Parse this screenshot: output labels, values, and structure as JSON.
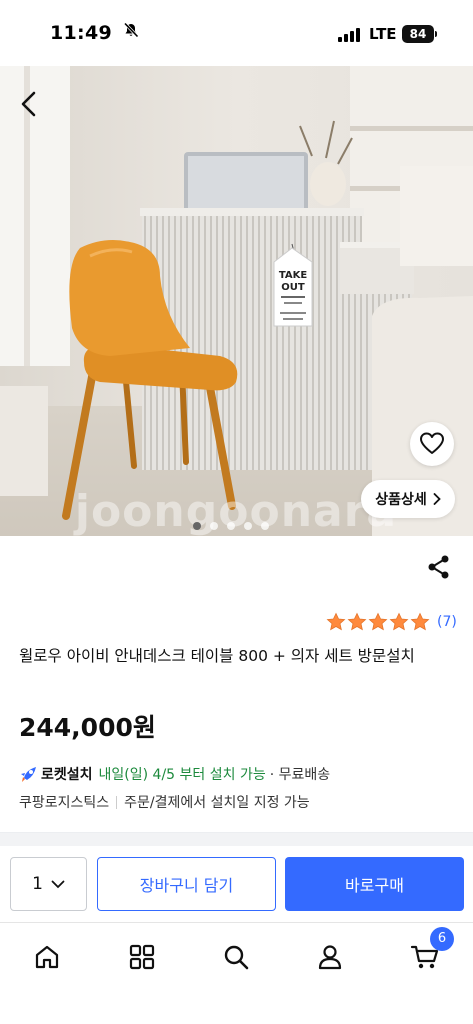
{
  "status_bar": {
    "time": "11:49",
    "network": "LTE",
    "battery": "84"
  },
  "hero": {
    "sign_line1": "TAKE",
    "sign_line2": "OUT",
    "watermark": "joongoonara",
    "detail_button_label": "상품상세",
    "carousel": {
      "count": 5,
      "active_index": 0
    },
    "icons": [
      "chevron-left-icon",
      "heart-icon",
      "chevron-right-icon"
    ]
  },
  "product": {
    "rating_stars": 5,
    "rating_count": "(7)",
    "title": "윌로우 아이비 안내데스크 테이블 800 + 의자 세트 방문설치",
    "price": "244,000원",
    "delivery": {
      "badge_label": "로켓설치",
      "date_text": "내일(일) 4/5 부터 설치 가능",
      "free_shipping": "· 무료배송"
    },
    "logistics": {
      "provider": "쿠팡로지스틱스",
      "note": "주문/결제에서 설치일 지정 가능"
    }
  },
  "actions": {
    "quantity": "1",
    "cart_label": "장바구니 담기",
    "buy_label": "바로구매"
  },
  "tab_bar": {
    "cart_badge": "6",
    "tabs": [
      "home-icon",
      "category-icon",
      "search-icon",
      "user-icon",
      "cart-icon"
    ]
  },
  "colors": {
    "accent": "#346aff",
    "star": "#ff8a3d",
    "delivery_green": "#1d8a3d",
    "chair": "#e59a2e"
  }
}
